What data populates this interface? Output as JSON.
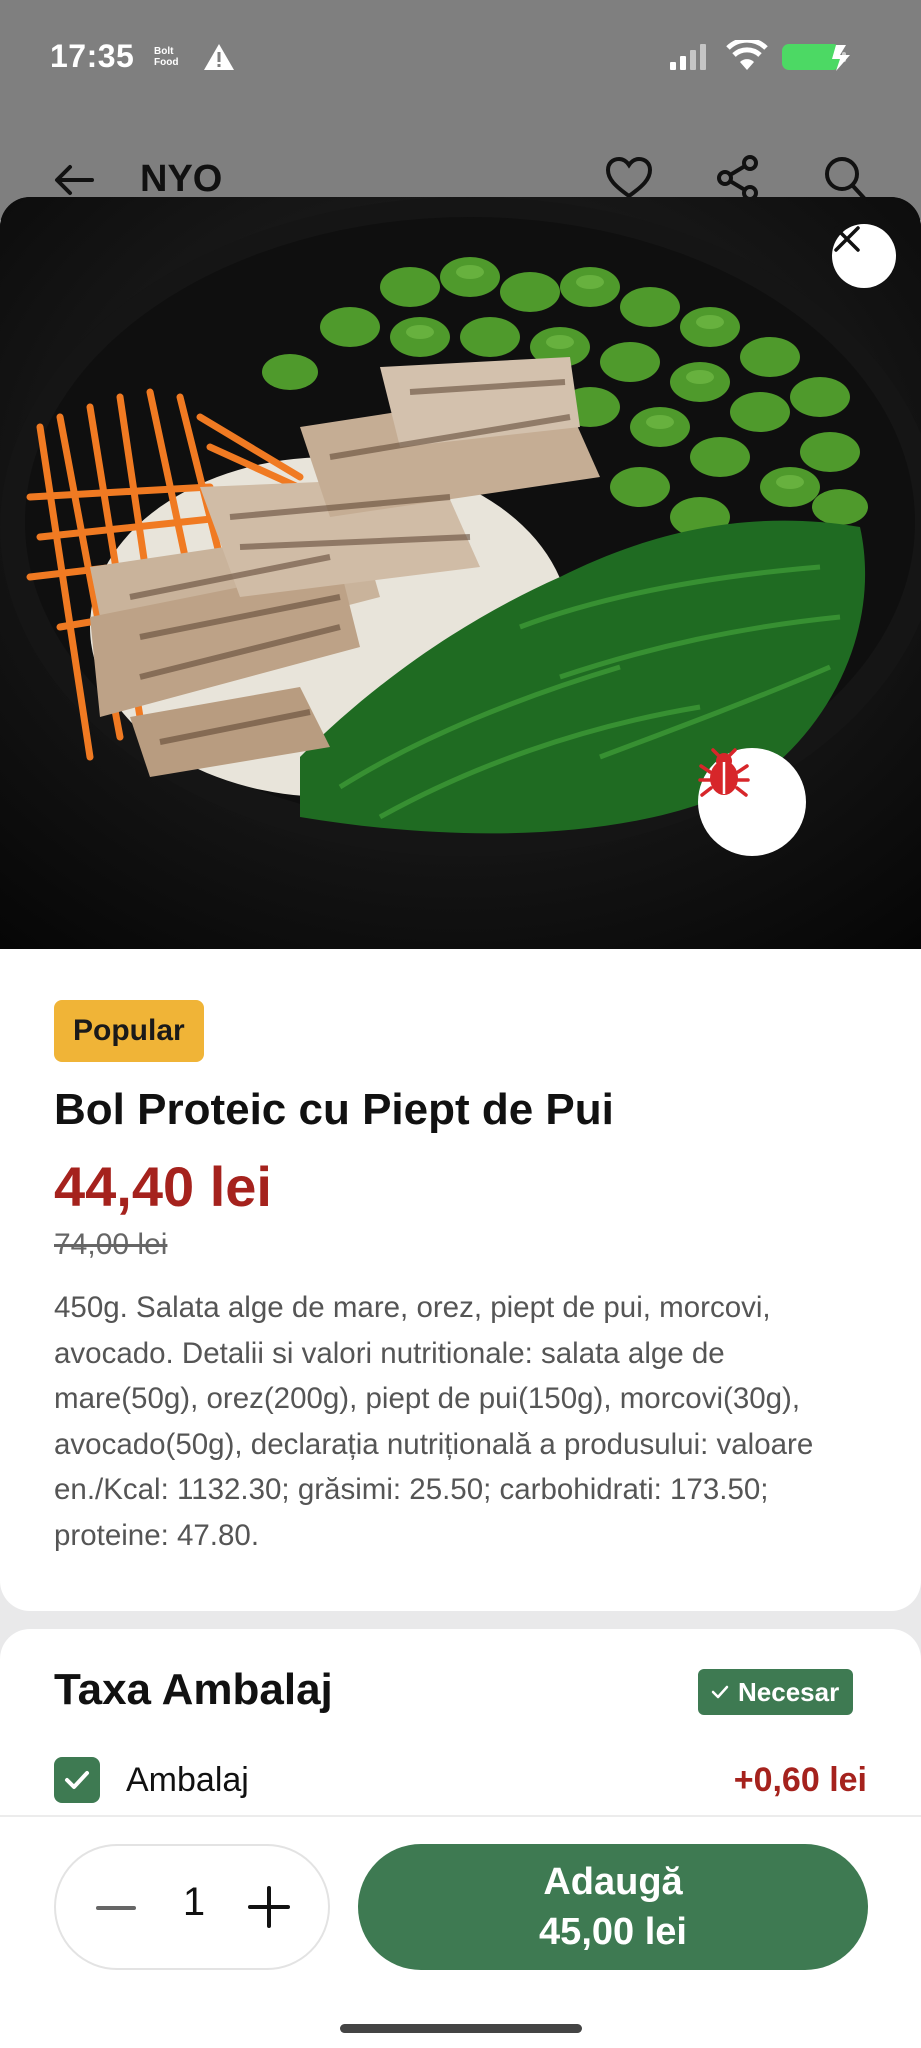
{
  "status_bar": {
    "time": "17:35",
    "brand_line1": "Bolt",
    "brand_line2": "Food",
    "icons": [
      "warning-icon",
      "signal-icon",
      "wifi-icon",
      "battery-charging-icon"
    ]
  },
  "background_header": {
    "title": "NYO",
    "icons": [
      "back-arrow-icon",
      "heart-icon",
      "share-icon",
      "search-icon"
    ]
  },
  "product": {
    "badge": "Popular",
    "title": "Bol Proteic cu Piept de Pui",
    "price": "44,40 lei",
    "old_price": "74,00 lei",
    "description": "450g. Salata alge de mare, orez, piept de pui, morcovi, avocado. Detalii si valori nutritionale: salata alge de mare(50g), orez(200g), piept de pui(150g), morcovi(30g), avocado(50g), declarația nutrițională a produsului: valoare en./Kcal: 1132.30; grăsimi: 25.50; carbohidrati: 173.50; proteine: 47.80."
  },
  "options": {
    "title": "Taxa Ambalaj",
    "required_label": "Necesar",
    "items": [
      {
        "label": "Ambalaj",
        "price": "+0,60 lei",
        "checked": true
      }
    ]
  },
  "cart": {
    "quantity": "1",
    "add_label": "Adaugă",
    "add_total": "45,00 lei"
  },
  "colors": {
    "accent_green": "#3e7a52",
    "price_red": "#a5221d",
    "badge_yellow": "#f0b437"
  }
}
